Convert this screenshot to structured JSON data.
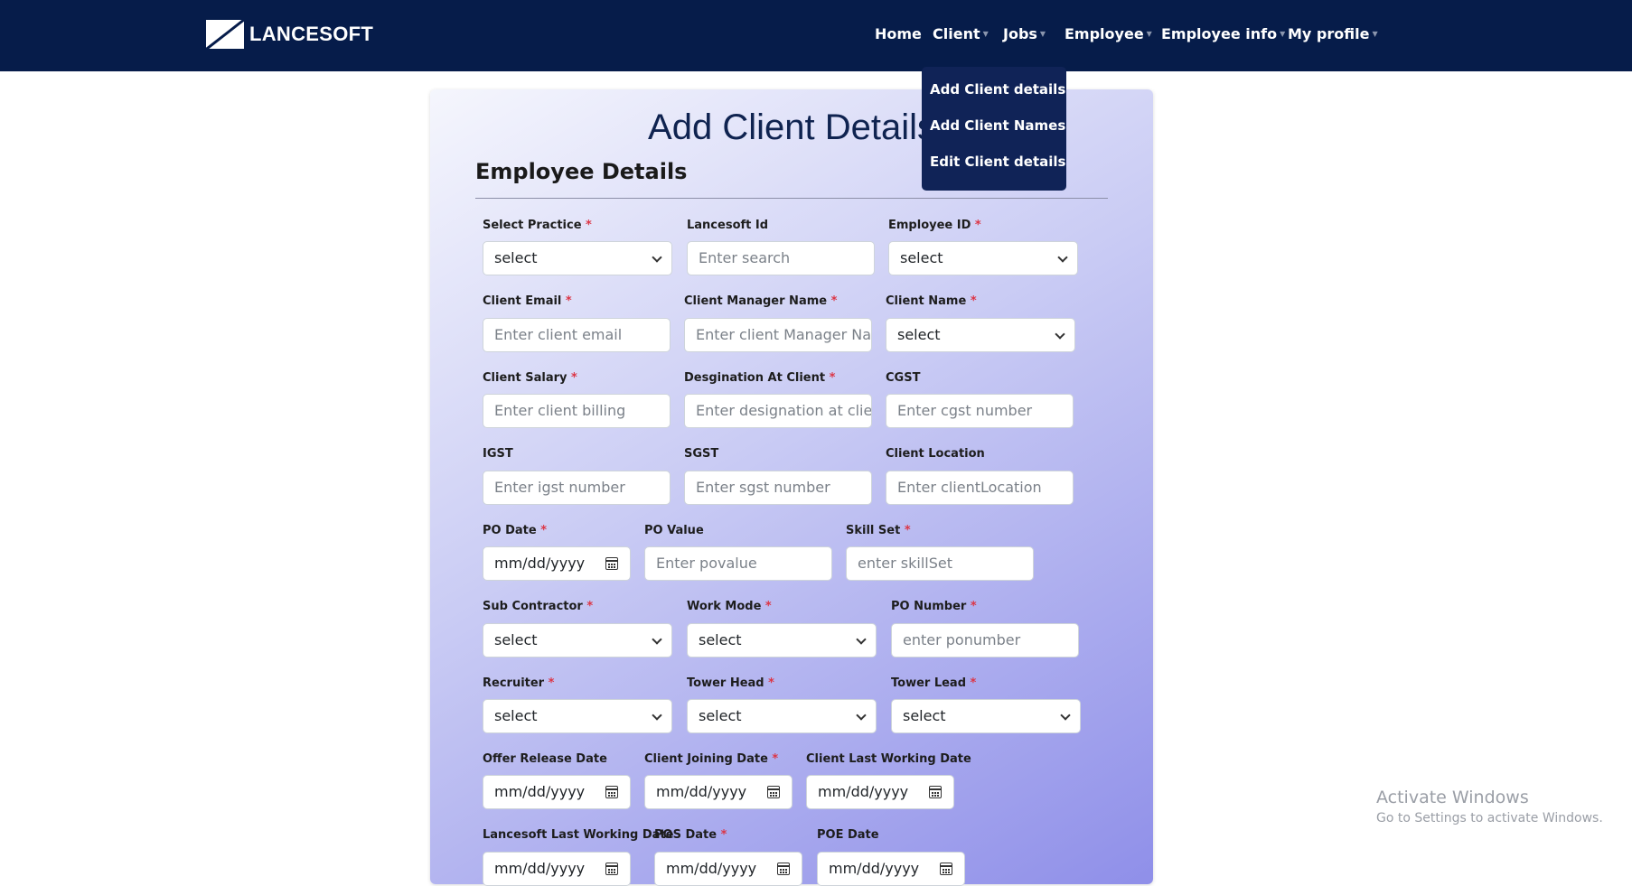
{
  "brand": {
    "name": "LANCESOFT"
  },
  "nav": {
    "home": "Home",
    "client": "Client",
    "jobs": "Jobs",
    "employee": "Employee",
    "employee_info": "Employee info",
    "my_profile": "My profile"
  },
  "client_menu": {
    "add_client_details": "Add Client details",
    "add_client_names": "Add Client Names",
    "edit_client_details": "Edit Client details"
  },
  "page": {
    "title": "Add Client Details",
    "section": "Employee Details"
  },
  "form": {
    "select_practice": {
      "label": "Select Practice",
      "value": "select"
    },
    "lancesoft_id": {
      "label": "Lancesoft Id",
      "placeholder": "Enter search"
    },
    "employee_id": {
      "label": "Employee ID",
      "value": "select"
    },
    "client_email": {
      "label": "Client Email",
      "placeholder": "Enter client email"
    },
    "client_manager_name": {
      "label": "Client Manager Name",
      "placeholder": "Enter client Manager Name"
    },
    "client_name": {
      "label": "Client Name",
      "value": "select"
    },
    "client_salary": {
      "label": "Client Salary",
      "placeholder": "Enter client billing"
    },
    "designation_at_client": {
      "label": "Desgination At Client",
      "placeholder": "Enter designation at client"
    },
    "cgst": {
      "label": "CGST",
      "placeholder": "Enter cgst number"
    },
    "igst": {
      "label": "IGST",
      "placeholder": "Enter igst number"
    },
    "sgst": {
      "label": "SGST",
      "placeholder": "Enter sgst number"
    },
    "client_location": {
      "label": "Client Location",
      "placeholder": "Enter clientLocation"
    },
    "po_date": {
      "label": "PO Date",
      "value": "mm/dd/yyyy"
    },
    "po_value": {
      "label": "PO Value",
      "placeholder": "Enter povalue"
    },
    "skill_set": {
      "label": "Skill Set",
      "placeholder": "enter skillSet"
    },
    "sub_contractor": {
      "label": "Sub Contractor",
      "value": "select"
    },
    "work_mode": {
      "label": "Work Mode",
      "value": "select"
    },
    "po_number": {
      "label": "PO Number",
      "placeholder": "enter ponumber"
    },
    "recruiter": {
      "label": "Recruiter",
      "value": "select"
    },
    "tower_head": {
      "label": "Tower Head",
      "value": "select"
    },
    "tower_lead": {
      "label": "Tower Lead",
      "value": "select"
    },
    "offer_release_date": {
      "label": "Offer Release Date",
      "value": "mm/dd/yyyy"
    },
    "client_joining_date": {
      "label": "Client Joining Date",
      "value": "mm/dd/yyyy"
    },
    "client_last_working_date": {
      "label": "Client Last Working Date",
      "value": "mm/dd/yyyy"
    },
    "lancesoft_last_working_date": {
      "label": "Lancesoft Last Working Date",
      "value": "mm/dd/yyyy"
    },
    "pos_date": {
      "label": "POS Date",
      "value": "mm/dd/yyyy"
    },
    "poe_date": {
      "label": "POE Date",
      "value": "mm/dd/yyyy"
    },
    "required_mark": "*"
  },
  "watermark": {
    "title": "Activate Windows",
    "subtitle": "Go to Settings to activate Windows."
  }
}
